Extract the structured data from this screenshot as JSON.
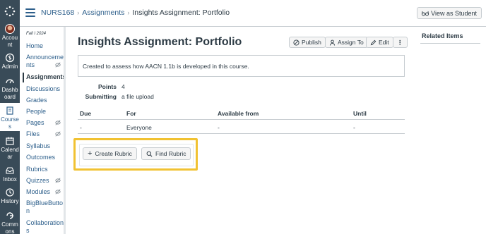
{
  "global_nav": {
    "items": [
      {
        "label": "Account",
        "icon": "avatar"
      },
      {
        "label": "Admin",
        "icon": "shield-icon"
      },
      {
        "label": "Dashboard",
        "icon": "dashboard-icon"
      },
      {
        "label": "Courses",
        "icon": "book-icon"
      },
      {
        "label": "Calendar",
        "icon": "calendar-icon"
      },
      {
        "label": "Inbox",
        "icon": "inbox-icon"
      },
      {
        "label": "History",
        "icon": "clock-icon"
      },
      {
        "label": "Commons",
        "icon": "commons-icon"
      }
    ],
    "account_lines": [
      "Accou",
      "nt"
    ],
    "dashboard_lines": [
      "Dashb",
      "oard"
    ],
    "courses_lines": [
      "Course",
      "s"
    ],
    "calendar_lines": [
      "Calend",
      "ar"
    ],
    "commons_lines": [
      "Comm",
      "ons"
    ]
  },
  "header": {
    "breadcrumbs": [
      "NURS168",
      "Assignments",
      "Insights Assignment: Portfolio"
    ],
    "view_as_student": "View as Student"
  },
  "course_nav": {
    "term": "Fall I 2024",
    "items": [
      {
        "label": "Home",
        "hidden": false
      },
      {
        "label": "Announcements",
        "hidden": true
      },
      {
        "label": "Assignments",
        "hidden": false,
        "active": true
      },
      {
        "label": "Discussions",
        "hidden": false
      },
      {
        "label": "Grades",
        "hidden": false
      },
      {
        "label": "People",
        "hidden": false
      },
      {
        "label": "Pages",
        "hidden": true
      },
      {
        "label": "Files",
        "hidden": true
      },
      {
        "label": "Syllabus",
        "hidden": false
      },
      {
        "label": "Outcomes",
        "hidden": false
      },
      {
        "label": "Rubrics",
        "hidden": false
      },
      {
        "label": "Quizzes",
        "hidden": true
      },
      {
        "label": "Modules",
        "hidden": true
      },
      {
        "label": "BigBlueButton",
        "hidden": false
      },
      {
        "label": "Collaborations",
        "hidden": false
      }
    ],
    "announcements_lines": [
      "Announceme",
      "nts"
    ],
    "bbb_lines": [
      "BigBlueButto",
      "n"
    ],
    "collab_lines": [
      "Collaboration",
      "s"
    ]
  },
  "assignment": {
    "title": "Insights Assignment: Portfolio",
    "buttons": {
      "publish": "Publish",
      "assign_to": "Assign To",
      "edit": "Edit"
    },
    "description": "Created to assess how AACN 1.1b is developed in this course.",
    "points_label": "Points",
    "points_value": "4",
    "submitting_label": "Submitting",
    "submitting_value": "a file upload",
    "table": {
      "headers": [
        "Due",
        "For",
        "Available from",
        "Until"
      ],
      "rows": [
        [
          "-",
          "Everyone",
          "-",
          "-"
        ]
      ]
    },
    "rubric_buttons": {
      "create": "Create Rubric",
      "find": "Find Rubric"
    }
  },
  "sidebar_right": {
    "related_items": "Related Items"
  },
  "colors": {
    "link": "#2d5f8b",
    "nav_bg": "#394b58",
    "highlight": "#f1c232"
  }
}
